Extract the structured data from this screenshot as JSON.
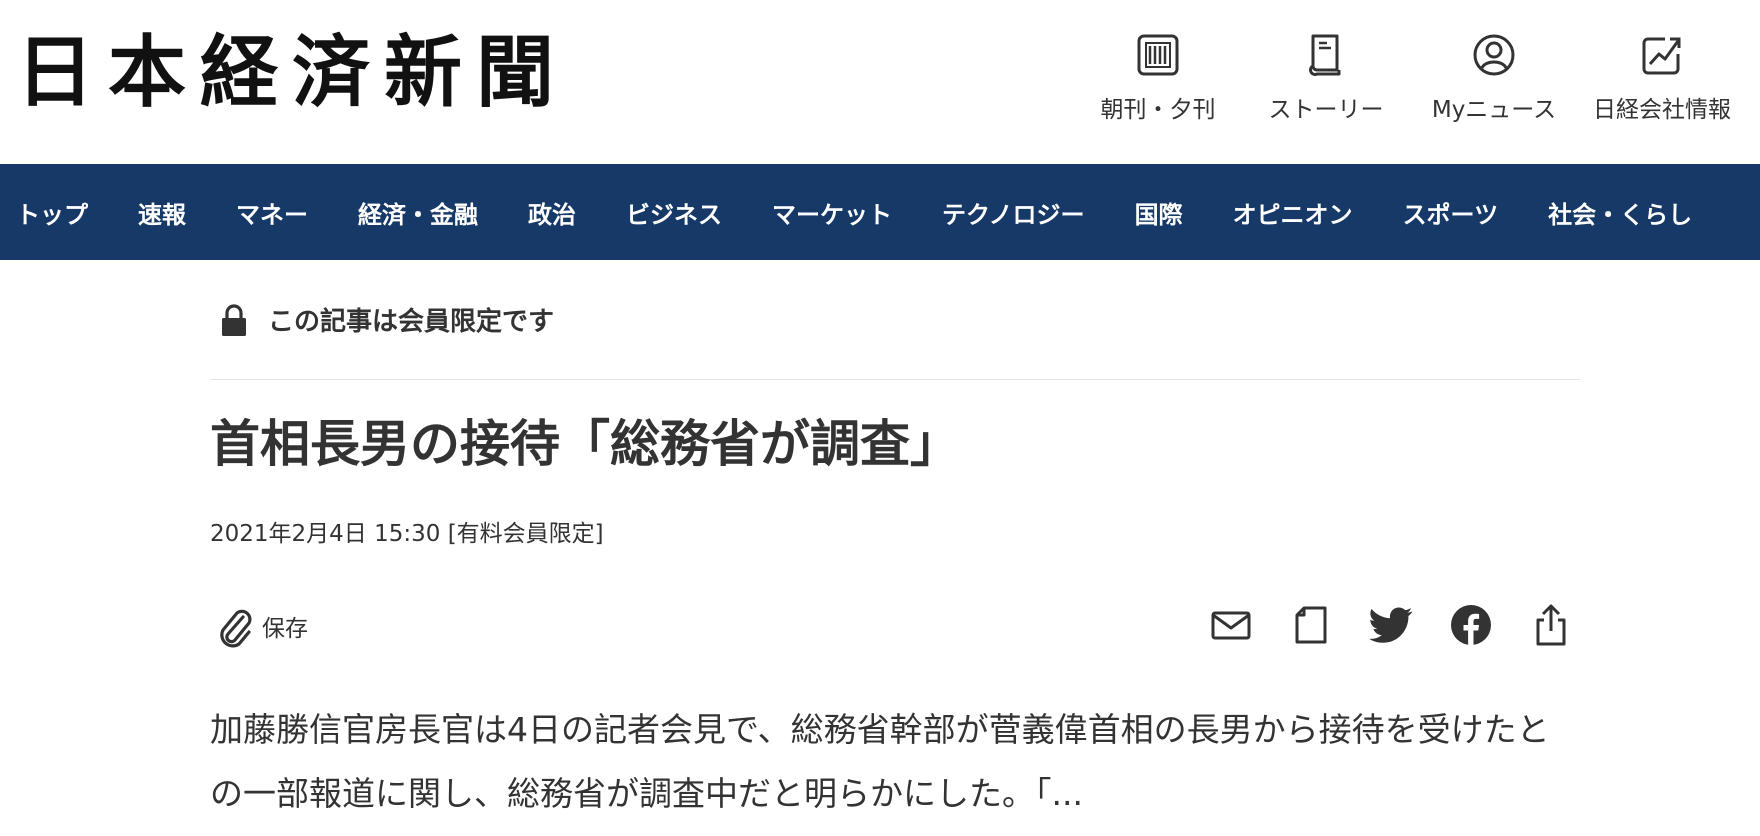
{
  "header": {
    "logo_text": "日本経済新聞",
    "nav": [
      {
        "label": "朝刊・夕刊",
        "icon": "newspaper-icon"
      },
      {
        "label": "ストーリー",
        "icon": "book-icon"
      },
      {
        "label": "Myニュース",
        "icon": "user-circle-icon"
      },
      {
        "label": "日経会社情報",
        "icon": "stock-chart-icon"
      }
    ]
  },
  "navbar": {
    "items": [
      "トップ",
      "速報",
      "マネー",
      "経済・金融",
      "政治",
      "ビジネス",
      "マーケット",
      "テクノロジー",
      "国際",
      "オピニオン",
      "スポーツ",
      "社会・くらし"
    ]
  },
  "article": {
    "members_only": "この記事は会員限定です",
    "title": "首相長男の接待「総務省が調査」",
    "dateline": "2021年2月4日 15:30 [有料会員限定]",
    "save_label": "保存",
    "share_icons": [
      "mail-icon",
      "note-icon",
      "twitter-icon",
      "facebook-icon",
      "share-icon"
    ],
    "lead": "加藤勝信官房長官は4日の記者会見で、総務省幹部が菅義偉首相の長男から接待を受けたとの一部報道に関し、総務省が調査中だと明らかにした。「..."
  },
  "colors": {
    "navbar_bg": "#163967",
    "text": "#333333"
  }
}
